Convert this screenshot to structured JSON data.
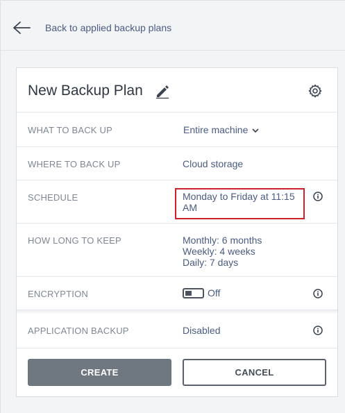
{
  "nav": {
    "back_label": "Back to applied backup plans"
  },
  "plan": {
    "title": "New Backup Plan"
  },
  "rows": {
    "what": {
      "label": "WHAT TO BACK UP",
      "value": "Entire machine"
    },
    "where": {
      "label": "WHERE TO BACK UP",
      "value": "Cloud storage"
    },
    "schedule": {
      "label": "SCHEDULE",
      "line1": "Monday to Friday at 11:15",
      "line2": "AM"
    },
    "keep": {
      "label": "HOW LONG TO KEEP",
      "monthly": "Monthly: 6 months",
      "weekly": "Weekly: 4 weeks",
      "daily": "Daily: 7 days"
    },
    "encryption": {
      "label": "ENCRYPTION",
      "value": "Off"
    },
    "application": {
      "label": "APPLICATION BACKUP",
      "value": "Disabled"
    }
  },
  "actions": {
    "create": "CREATE",
    "cancel": "CANCEL"
  },
  "colors": {
    "highlight": "#d0202a",
    "link": "#4a5b82",
    "primary_button": "#6f7781"
  },
  "icons": {
    "back": "arrow-left-icon",
    "edit": "pencil-icon",
    "settings": "gear-icon",
    "info": "info-icon",
    "dropdown": "chevron-down-icon"
  }
}
